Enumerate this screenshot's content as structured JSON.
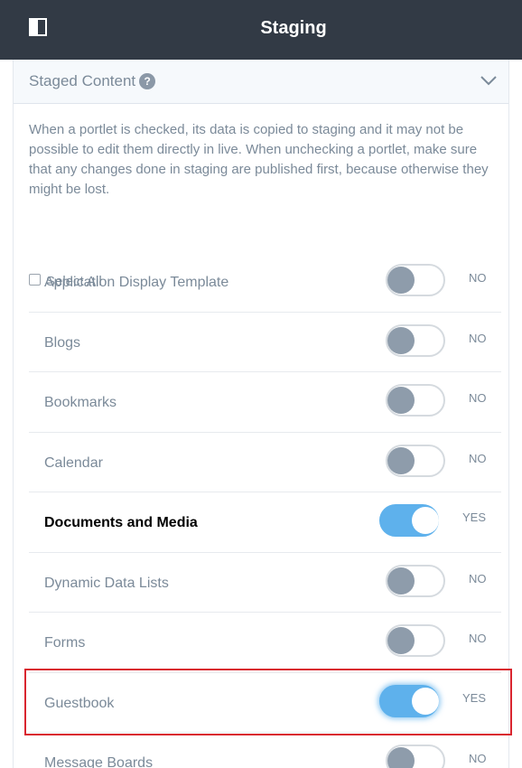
{
  "topbar": {
    "title": "Staging",
    "toggle_icon": "panel-toggle-icon"
  },
  "panel": {
    "title": "Staged Content",
    "help_glyph": "?",
    "description": "When a portlet is checked, its data is copied to staging and it may not be possible to edit them directly in live. When unchecking a portlet, make sure that any changes done in staging are published first, because otherwise they might be lost.",
    "select_all": "Select All"
  },
  "portlets": [
    {
      "label": "Application Display Template",
      "state": "NO"
    },
    {
      "label": "Blogs",
      "state": "NO"
    },
    {
      "label": "Bookmarks",
      "state": "NO"
    },
    {
      "label": "Calendar",
      "state": "NO"
    },
    {
      "label": "Documents and Media",
      "state": "YES"
    },
    {
      "label": "Dynamic Data Lists",
      "state": "NO"
    },
    {
      "label": "Forms",
      "state": "NO"
    },
    {
      "label": "Guestbook",
      "state": "YES"
    },
    {
      "label": "Message Boards",
      "state": "NO"
    }
  ],
  "colors": {
    "topbar": "#323a45",
    "toggle_on": "#5eb1ec",
    "toggle_off_knob": "#8e9cab",
    "highlight": "#d9252f"
  }
}
